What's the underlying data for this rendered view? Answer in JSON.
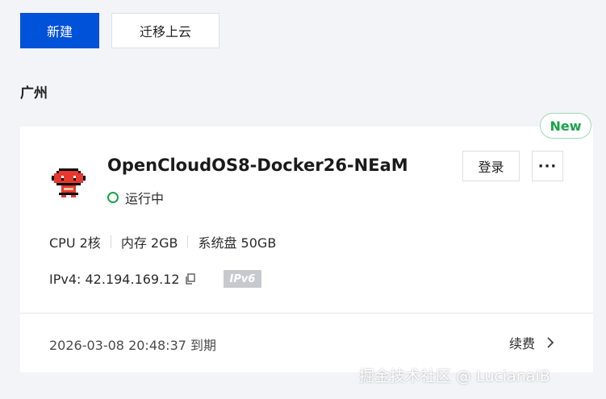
{
  "toolbar": {
    "new_label": "新建",
    "migrate_label": "迁移上云"
  },
  "region": "广州",
  "card": {
    "badge": "New",
    "title": "OpenCloudOS8-Docker26-NEaM",
    "status": "运行中",
    "login_label": "登录",
    "more_label": "···",
    "specs": {
      "cpu": "CPU 2核",
      "memory": "内存 2GB",
      "disk": "系统盘 50GB"
    },
    "ipv4": "IPv4: 42.194.169.12",
    "ipv6_badge": "IPv6",
    "expiry": "2026-03-08 20:48:37 到期",
    "renew_label": "续费"
  },
  "watermark": "掘金技术社区 @ LucianaiB",
  "colors": {
    "primary": "#0052d9",
    "running": "#1aa34a",
    "logo_red": "#e8382e"
  }
}
